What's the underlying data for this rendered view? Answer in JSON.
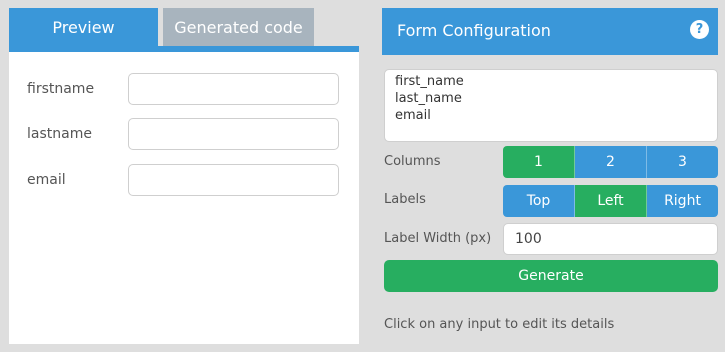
{
  "tabs": {
    "preview": "Preview",
    "generated_code": "Generated code"
  },
  "preview": {
    "fields": [
      {
        "label": "firstname",
        "value": ""
      },
      {
        "label": "lastname",
        "value": ""
      },
      {
        "label": "email",
        "value": ""
      }
    ]
  },
  "config": {
    "title": "Form Configuration",
    "help_icon": "help-icon",
    "help_glyph": "?",
    "fields_text": "first_name\nlast_name\nemail",
    "columns": {
      "label": "Columns",
      "options": [
        "1",
        "2",
        "3"
      ],
      "selected": "1"
    },
    "labels": {
      "label": "Labels",
      "options": [
        "Top",
        "Left",
        "Right"
      ],
      "selected": "Left"
    },
    "label_width": {
      "label": "Label Width (px)",
      "value": "100"
    },
    "generate_label": "Generate",
    "hint": "Click on any input to edit its details"
  },
  "colors": {
    "accent_blue": "#3a97d9",
    "selected_green": "#27ae60",
    "inactive_tab": "#a8b4be",
    "background": "#dedede"
  }
}
